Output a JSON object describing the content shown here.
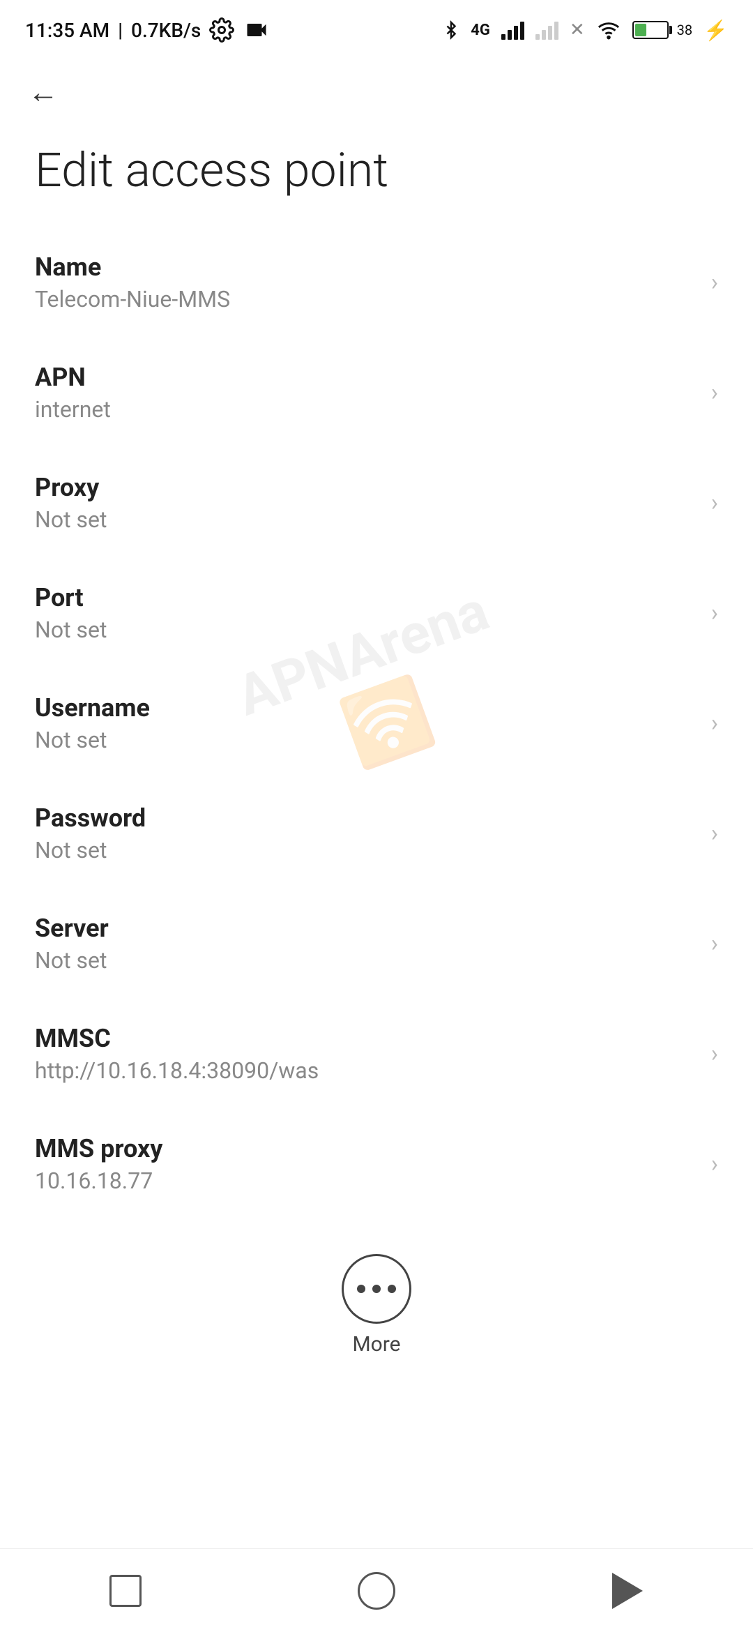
{
  "statusBar": {
    "time": "11:35 AM",
    "speed": "0.7KB/s",
    "batteryPercent": "38"
  },
  "header": {
    "back_label": "←",
    "title": "Edit access point"
  },
  "settings": {
    "items": [
      {
        "label": "Name",
        "value": "Telecom-Niue-MMS"
      },
      {
        "label": "APN",
        "value": "internet"
      },
      {
        "label": "Proxy",
        "value": "Not set"
      },
      {
        "label": "Port",
        "value": "Not set"
      },
      {
        "label": "Username",
        "value": "Not set"
      },
      {
        "label": "Password",
        "value": "Not set"
      },
      {
        "label": "Server",
        "value": "Not set"
      },
      {
        "label": "MMSC",
        "value": "http://10.16.18.4:38090/was"
      },
      {
        "label": "MMS proxy",
        "value": "10.16.18.77"
      }
    ]
  },
  "more": {
    "label": "More"
  },
  "navbar": {
    "square_label": "recent-apps",
    "circle_label": "home",
    "triangle_label": "back"
  }
}
